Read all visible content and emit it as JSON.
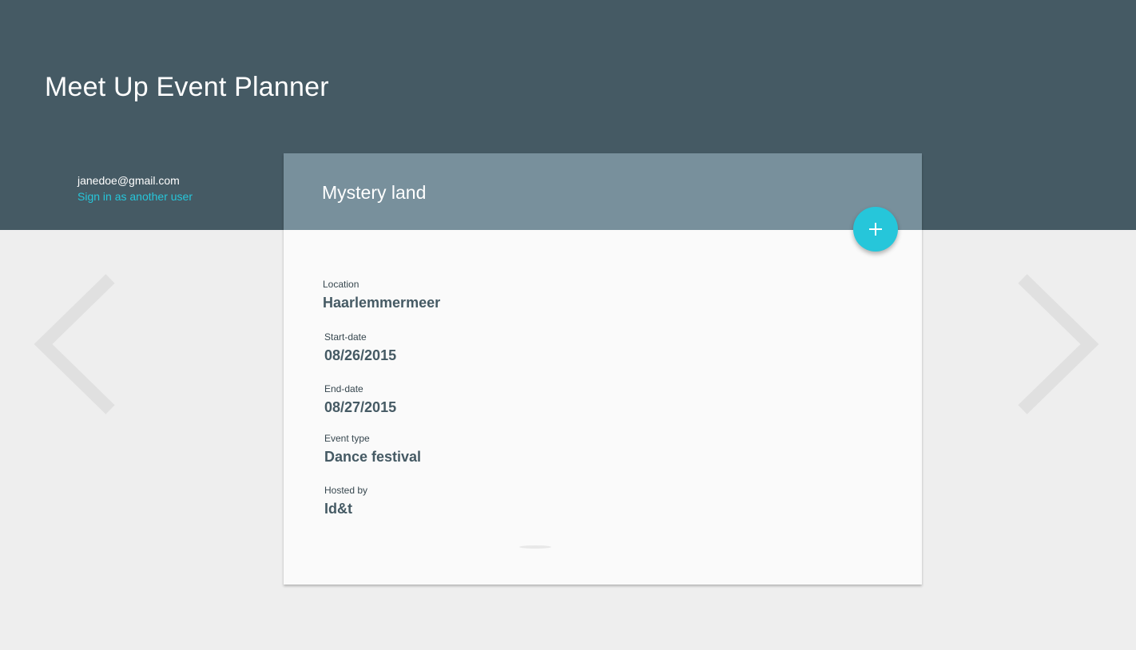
{
  "app": {
    "title": "Meet Up Event Planner"
  },
  "user": {
    "email": "janedoe@gmail.com",
    "switch_label": "Sign in as another user"
  },
  "event": {
    "name": "Mystery land",
    "fields": [
      {
        "label": "Location",
        "value": "Haarlemmermeer"
      },
      {
        "label": "Start-date",
        "value": "08/26/2015"
      },
      {
        "label": "End-date",
        "value": "08/27/2015"
      },
      {
        "label": "Event type",
        "value": "Dance festival"
      },
      {
        "label": "Hosted by",
        "value": "Id&t"
      }
    ]
  },
  "icons": {
    "fab": "plus-icon",
    "prev": "chevron-left-icon",
    "next": "chevron-right-icon"
  },
  "colors": {
    "header_bg": "#455a64",
    "card_header_bg": "#78909c",
    "accent": "#26c6da",
    "page_bg": "#eeeeee",
    "card_bg": "#fafafa"
  }
}
